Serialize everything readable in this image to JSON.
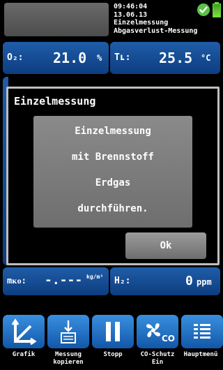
{
  "header": {
    "time": "09:46:04",
    "date": "13.06.13",
    "mode": "Einzelmessung",
    "measurement": "Abgasverlust-Messung"
  },
  "tiles": {
    "o2": {
      "label": "O₂:",
      "value": "21.0",
      "unit": "%"
    },
    "tl": {
      "label": "Tʟ:",
      "value": "25.5",
      "unit": "°C"
    },
    "mko": {
      "label": "mᴋᴏ:",
      "value": "-.---",
      "unit": "kg/m³"
    },
    "h2": {
      "label": "H₂:",
      "value": "0",
      "unit": "ppm"
    }
  },
  "dialog": {
    "title": "Einzelmessung",
    "lines": [
      "Einzelmessung",
      "mit Brennstoff",
      "Erdgas",
      "durchführen."
    ],
    "ok_label": "Ok"
  },
  "toolbar": {
    "buttons": [
      {
        "icon": "chart-axes-icon",
        "label_1": "Grafik",
        "label_2": ""
      },
      {
        "icon": "copy-measurement-icon",
        "label_1": "Messung",
        "label_2": "kopieren"
      },
      {
        "icon": "pause-icon",
        "label_1": "Stopp",
        "label_2": ""
      },
      {
        "icon": "fan-co-icon",
        "label_1": "CO-Schutz",
        "label_2": "Ein"
      },
      {
        "icon": "menu-icon",
        "label_1": "Hauptmenü",
        "label_2": ""
      }
    ]
  },
  "colors": {
    "tile_blue": "#1a4f95",
    "toolbar_blue": "#2479cf",
    "status_green": "#5cc14a",
    "dialog_gray": "#7a7a7a"
  }
}
